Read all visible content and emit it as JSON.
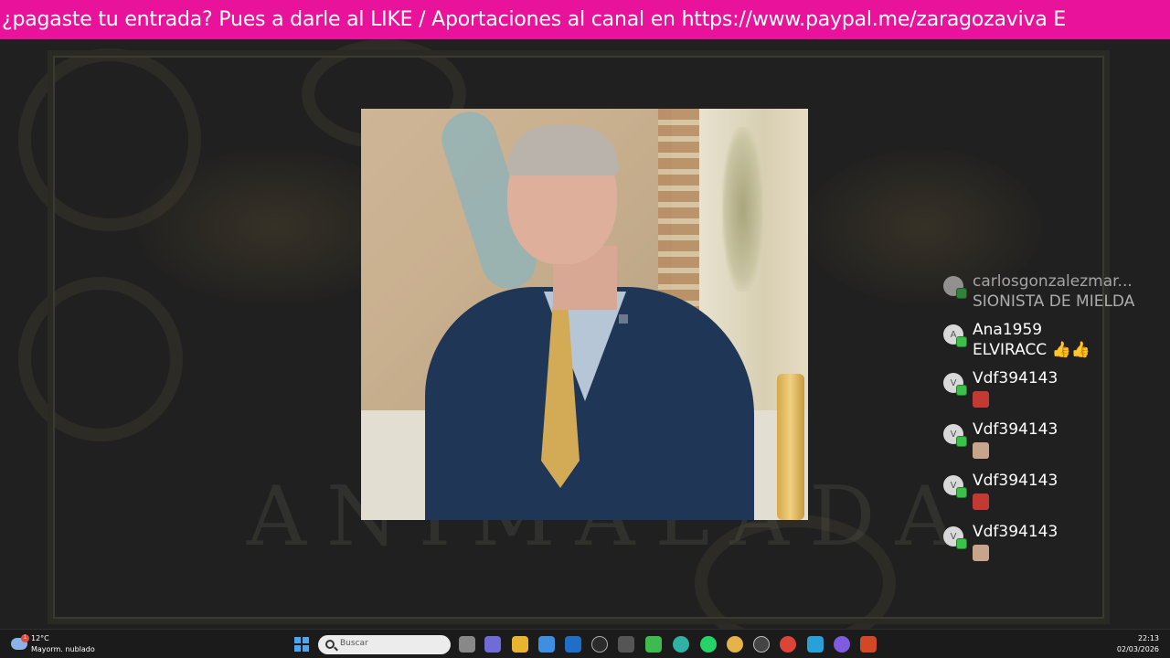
{
  "ticker": {
    "text": "¿pagaste tu entrada? Pues a darle al LIKE / Aportaciones al canal en https://www.paypal.me/zaragozaviva E"
  },
  "stage": {
    "watermark": "ANIMALADA"
  },
  "chat": {
    "messages": [
      {
        "avatar": "",
        "user": "carlosgonzalezmar...",
        "text": "SIONISTA DE MIELDA",
        "faded": true
      },
      {
        "avatar": "A",
        "user": "Ana1959",
        "text": "ELVIRACC 👍👍",
        "faded": false
      },
      {
        "avatar": "V",
        "user": "Vdf394143",
        "emote": "angry-emote",
        "faded": false
      },
      {
        "avatar": "V",
        "user": "Vdf394143",
        "emote": "face-emote",
        "faded": false
      },
      {
        "avatar": "V",
        "user": "Vdf394143",
        "emote": "angry-emote",
        "faded": false
      },
      {
        "avatar": "V",
        "user": "Vdf394143",
        "emote": "face-emote",
        "faded": false
      }
    ]
  },
  "taskbar": {
    "weather": {
      "temp": "12°C",
      "desc": "Mayorm. nublado",
      "alert": "1"
    },
    "search_placeholder": "Buscar",
    "apps": [
      "task-view-icon",
      "teams-icon",
      "file-explorer-icon",
      "store-icon",
      "mail-icon",
      "github-icon",
      "app-icon",
      "camtasia-icon",
      "edge-icon",
      "whatsapp-icon",
      "chrome-beta-icon",
      "obs-icon",
      "chrome-icon",
      "telegram-icon",
      "circle-app-icon",
      "powerpoint-icon"
    ],
    "clock": {
      "time": "22:13",
      "date": "02/03/2026"
    }
  }
}
